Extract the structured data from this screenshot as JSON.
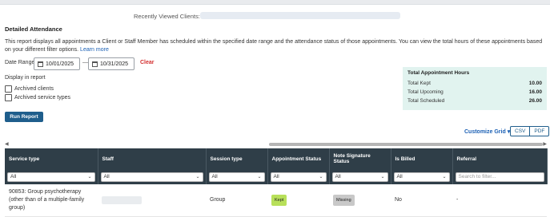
{
  "header": {
    "recently_viewed_label": "Recently Viewed Clients:"
  },
  "report": {
    "title": "Detailed Attendance",
    "description": "This report displays all appointments a Client or Staff Member has scheduled within the specified date range and the attendance status of those appointments. You can view the total hours of these appointments based on your different filter options.",
    "learn_more": "Learn more"
  },
  "filters": {
    "date_range_label": "Date Range",
    "start_date": "10/01/2025",
    "end_date": "10/31/2025",
    "date_separator": "—",
    "clear_label": "Clear",
    "display_label": "Display in report",
    "archived_clients_label": "Archived clients",
    "archived_service_types_label": "Archived service types",
    "run_report_label": "Run Report"
  },
  "totals": {
    "title": "Total Appointment Hours",
    "rows": [
      {
        "label": "Total Kept",
        "value": "10.00"
      },
      {
        "label": "Total Upcoming",
        "value": "16.00"
      },
      {
        "label": "Total Scheduled",
        "value": "26.00"
      }
    ]
  },
  "toolbar": {
    "customize_grid_label": "Customize Grid",
    "csv_label": "CSV",
    "pdf_label": "PDF"
  },
  "grid": {
    "columns": [
      "Service type",
      "Staff",
      "Session type",
      "Appointment Status",
      "Note Signature Status",
      "Is Billed",
      "Referral"
    ],
    "filter_all": "All",
    "referral_placeholder": "Search to filter...",
    "rows": [
      {
        "service_type": "90853: Group psychotherapy (other than of a multiple-family group)",
        "session_type": "Group",
        "appointment_status": "Kept",
        "note_signature_status": "Missing",
        "is_billed": "No",
        "referral": "-"
      }
    ]
  },
  "colors": {
    "header_bg": "#2f3e48",
    "primary_button": "#1f5e8c",
    "totals_bg": "#e1f3ef",
    "kept_badge": "#b8e05a",
    "missing_badge": "#c8c8c8",
    "clear_link": "#d32f2f"
  }
}
